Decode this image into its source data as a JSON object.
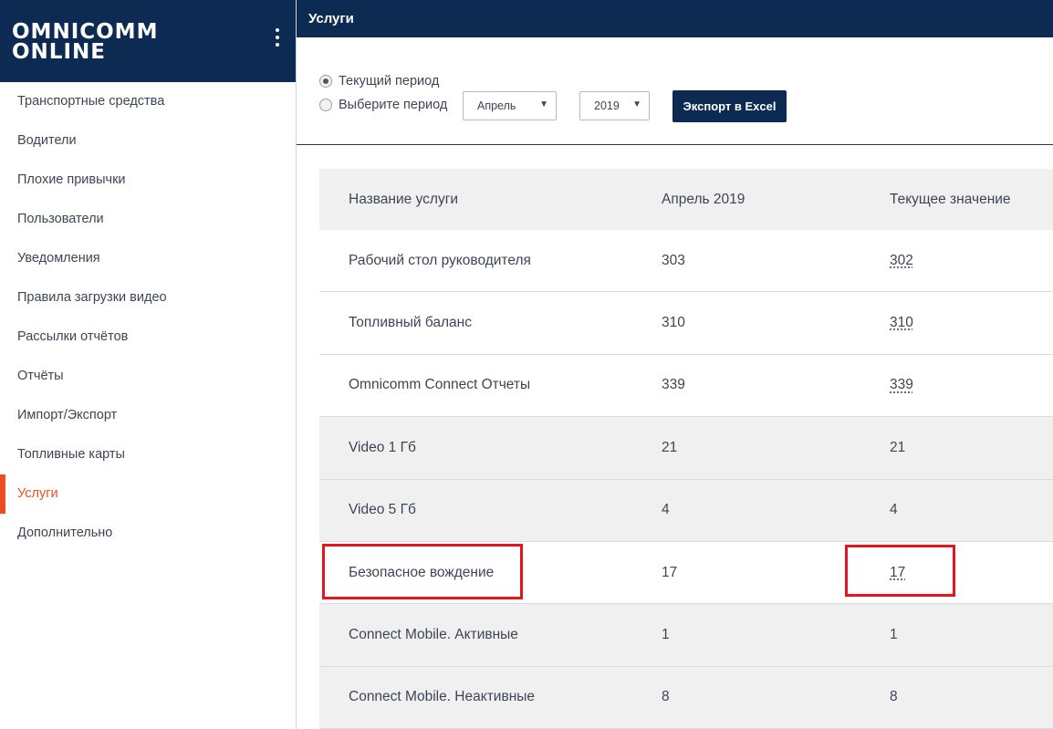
{
  "app": {
    "logo_line1": "OMNICOMM",
    "logo_line2": "ONLINE",
    "menu_icon": "vertical-dots-icon"
  },
  "sidebar": {
    "items": [
      {
        "label": "Транспортные средства",
        "active": false
      },
      {
        "label": "Водители",
        "active": false
      },
      {
        "label": "Плохие привычки",
        "active": false
      },
      {
        "label": "Пользователи",
        "active": false
      },
      {
        "label": "Уведомления",
        "active": false
      },
      {
        "label": "Правила загрузки видео",
        "active": false
      },
      {
        "label": "Рассылки отчётов",
        "active": false
      },
      {
        "label": "Отчёты",
        "active": false
      },
      {
        "label": "Импорт/Экспорт",
        "active": false
      },
      {
        "label": "Топливные карты",
        "active": false
      },
      {
        "label": "Услуги",
        "active": true
      },
      {
        "label": "Дополнительно",
        "active": false
      }
    ]
  },
  "header": {
    "title": "Услуги"
  },
  "filters": {
    "radio_current": {
      "label": "Текущий период",
      "checked": true
    },
    "radio_select": {
      "label": "Выберите период",
      "checked": false
    },
    "month_select": "Апрель",
    "year_select": "2019",
    "export_button": "Экспорт в Excel"
  },
  "table": {
    "headers": [
      "Название услуги",
      "Апрель 2019",
      "Текущее значение"
    ],
    "rows": [
      {
        "name": "Рабочий стол руководителя",
        "period": "303",
        "current": "302",
        "current_link": true,
        "highlighted": false
      },
      {
        "name": "Топливный баланс",
        "period": "310",
        "current": "310",
        "current_link": true,
        "highlighted": false
      },
      {
        "name": "Omnicomm Connect Отчеты",
        "period": "339",
        "current": "339",
        "current_link": true,
        "highlighted": false
      },
      {
        "name": "Video 1 Гб",
        "period": "21",
        "current": "21",
        "current_link": false,
        "highlighted": false
      },
      {
        "name": "Video 5 Гб",
        "period": "4",
        "current": "4",
        "current_link": false,
        "highlighted": false
      },
      {
        "name": "Безопасное вождение",
        "period": "17",
        "current": "17",
        "current_link": true,
        "highlighted": true
      },
      {
        "name": "Connect Mobile. Активные",
        "period": "1",
        "current": "1",
        "current_link": false,
        "highlighted": false
      },
      {
        "name": "Connect Mobile. Неактивные",
        "period": "8",
        "current": "8",
        "current_link": false,
        "highlighted": false
      }
    ]
  },
  "colors": {
    "brand_navy": "#0c2a52",
    "active_orange": "#ee4c23",
    "highlight_red": "#e8141c"
  }
}
